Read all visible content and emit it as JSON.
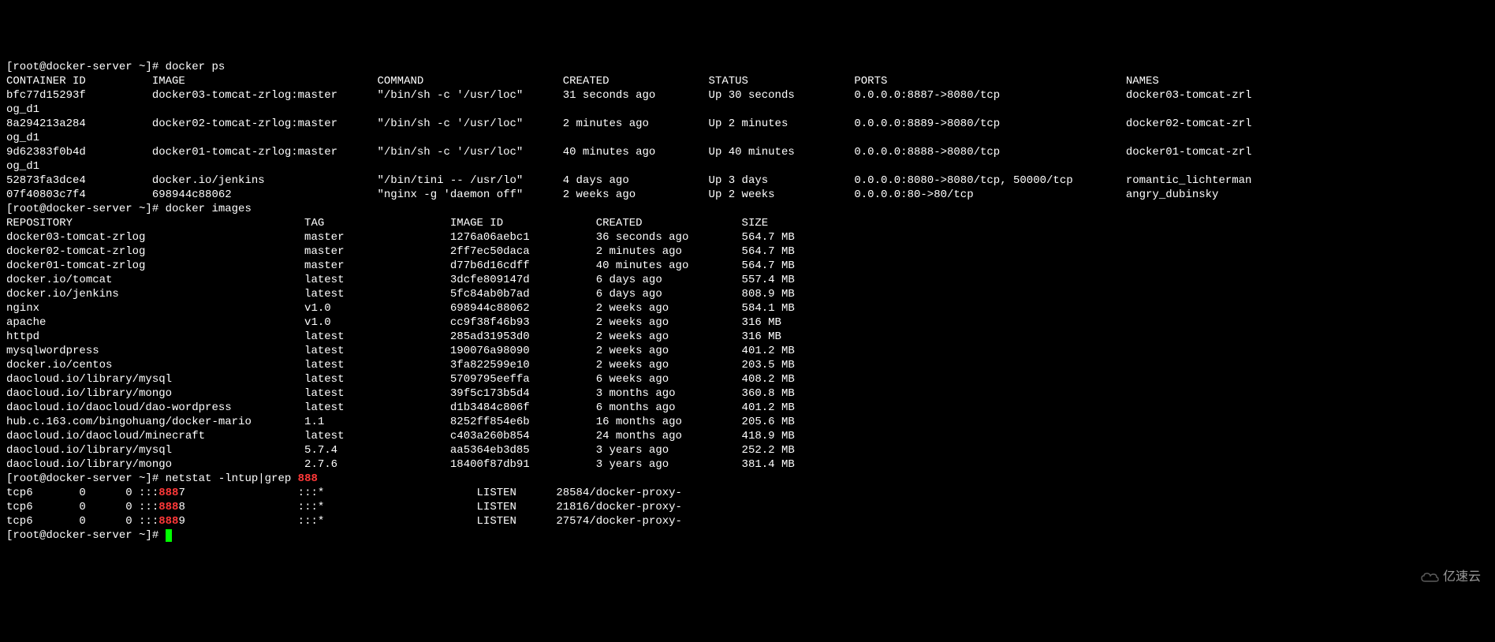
{
  "prompts": {
    "p1": "[root@docker-server ~]# ",
    "cmd1": "docker ps",
    "cmd2": "docker images",
    "cmd3_pre": "netstat -lntup|grep ",
    "cmd3_hl": "888"
  },
  "ps": {
    "headers": {
      "id": "CONTAINER ID",
      "image": "IMAGE",
      "command": "COMMAND",
      "created": "CREATED",
      "status": "STATUS",
      "ports": "PORTS",
      "names": "NAMES"
    },
    "rows": [
      {
        "id": "bfc77d15293f",
        "image": "docker03-tomcat-zrlog:master",
        "command": "\"/bin/sh -c '/usr/loc\"",
        "created": "31 seconds ago",
        "status": "Up 30 seconds",
        "ports": "0.0.0.0:8887->8080/tcp",
        "names": "docker03-tomcat-zrl",
        "wrap": "og_d1"
      },
      {
        "id": "8a294213a284",
        "image": "docker02-tomcat-zrlog:master",
        "command": "\"/bin/sh -c '/usr/loc\"",
        "created": "2 minutes ago",
        "status": "Up 2 minutes",
        "ports": "0.0.0.0:8889->8080/tcp",
        "names": "docker02-tomcat-zrl",
        "wrap": "og_d1"
      },
      {
        "id": "9d62383f0b4d",
        "image": "docker01-tomcat-zrlog:master",
        "command": "\"/bin/sh -c '/usr/loc\"",
        "created": "40 minutes ago",
        "status": "Up 40 minutes",
        "ports": "0.0.0.0:8888->8080/tcp",
        "names": "docker01-tomcat-zrl",
        "wrap": "og_d1"
      },
      {
        "id": "52873fa3dce4",
        "image": "docker.io/jenkins",
        "command": "\"/bin/tini -- /usr/lo\"",
        "created": "4 days ago",
        "status": "Up 3 days",
        "ports": "0.0.0.0:8080->8080/tcp, 50000/tcp",
        "names": "romantic_lichterman",
        "wrap": ""
      },
      {
        "id": "07f40803c7f4",
        "image": "698944c88062",
        "command": "\"nginx -g 'daemon off\"",
        "created": "2 weeks ago",
        "status": "Up 2 weeks",
        "ports": "0.0.0.0:80->80/tcp",
        "names": "angry_dubinsky",
        "wrap": ""
      }
    ]
  },
  "images": {
    "headers": {
      "repo": "REPOSITORY",
      "tag": "TAG",
      "id": "IMAGE ID",
      "created": "CREATED",
      "size": "SIZE"
    },
    "rows": [
      {
        "repo": "docker03-tomcat-zrlog",
        "tag": "master",
        "id": "1276a06aebc1",
        "created": "36 seconds ago",
        "size": "564.7 MB"
      },
      {
        "repo": "docker02-tomcat-zrlog",
        "tag": "master",
        "id": "2ff7ec50daca",
        "created": "2 minutes ago",
        "size": "564.7 MB"
      },
      {
        "repo": "docker01-tomcat-zrlog",
        "tag": "master",
        "id": "d77b6d16cdff",
        "created": "40 minutes ago",
        "size": "564.7 MB"
      },
      {
        "repo": "docker.io/tomcat",
        "tag": "latest",
        "id": "3dcfe809147d",
        "created": "6 days ago",
        "size": "557.4 MB"
      },
      {
        "repo": "docker.io/jenkins",
        "tag": "latest",
        "id": "5fc84ab0b7ad",
        "created": "6 days ago",
        "size": "808.9 MB"
      },
      {
        "repo": "nginx",
        "tag": "v1.0",
        "id": "698944c88062",
        "created": "2 weeks ago",
        "size": "584.1 MB"
      },
      {
        "repo": "apache",
        "tag": "v1.0",
        "id": "cc9f38f46b93",
        "created": "2 weeks ago",
        "size": "316 MB"
      },
      {
        "repo": "httpd",
        "tag": "latest",
        "id": "285ad31953d0",
        "created": "2 weeks ago",
        "size": "316 MB"
      },
      {
        "repo": "mysqlwordpress",
        "tag": "latest",
        "id": "190076a98090",
        "created": "2 weeks ago",
        "size": "401.2 MB"
      },
      {
        "repo": "docker.io/centos",
        "tag": "latest",
        "id": "3fa822599e10",
        "created": "2 weeks ago",
        "size": "203.5 MB"
      },
      {
        "repo": "daocloud.io/library/mysql",
        "tag": "latest",
        "id": "5709795eeffa",
        "created": "6 weeks ago",
        "size": "408.2 MB"
      },
      {
        "repo": "daocloud.io/library/mongo",
        "tag": "latest",
        "id": "39f5c173b5d4",
        "created": "3 months ago",
        "size": "360.8 MB"
      },
      {
        "repo": "daocloud.io/daocloud/dao-wordpress",
        "tag": "latest",
        "id": "d1b3484c806f",
        "created": "6 months ago",
        "size": "401.2 MB"
      },
      {
        "repo": "hub.c.163.com/bingohuang/docker-mario",
        "tag": "1.1",
        "id": "8252ff854e6b",
        "created": "16 months ago",
        "size": "205.6 MB"
      },
      {
        "repo": "daocloud.io/daocloud/minecraft",
        "tag": "latest",
        "id": "c403a260b854",
        "created": "24 months ago",
        "size": "418.9 MB"
      },
      {
        "repo": "daocloud.io/library/mysql",
        "tag": "5.7.4",
        "id": "aa5364eb3d85",
        "created": "3 years ago",
        "size": "252.2 MB"
      },
      {
        "repo": "daocloud.io/library/mongo",
        "tag": "2.7.6",
        "id": "18400f87db91",
        "created": "3 years ago",
        "size": "381.4 MB"
      }
    ]
  },
  "netstat": {
    "rows": [
      {
        "proto": "tcp6",
        "recv": "0",
        "send": "0",
        "local_pre": ":::",
        "local_hl": "888",
        "local_post": "7",
        "foreign": ":::*",
        "state": "LISTEN",
        "pid": "28584/docker-proxy-"
      },
      {
        "proto": "tcp6",
        "recv": "0",
        "send": "0",
        "local_pre": ":::",
        "local_hl": "888",
        "local_post": "8",
        "foreign": ":::*",
        "state": "LISTEN",
        "pid": "21816/docker-proxy-"
      },
      {
        "proto": "tcp6",
        "recv": "0",
        "send": "0",
        "local_pre": ":::",
        "local_hl": "888",
        "local_post": "9",
        "foreign": ":::*",
        "state": "LISTEN",
        "pid": "27574/docker-proxy-"
      }
    ]
  },
  "watermark": "亿速云"
}
